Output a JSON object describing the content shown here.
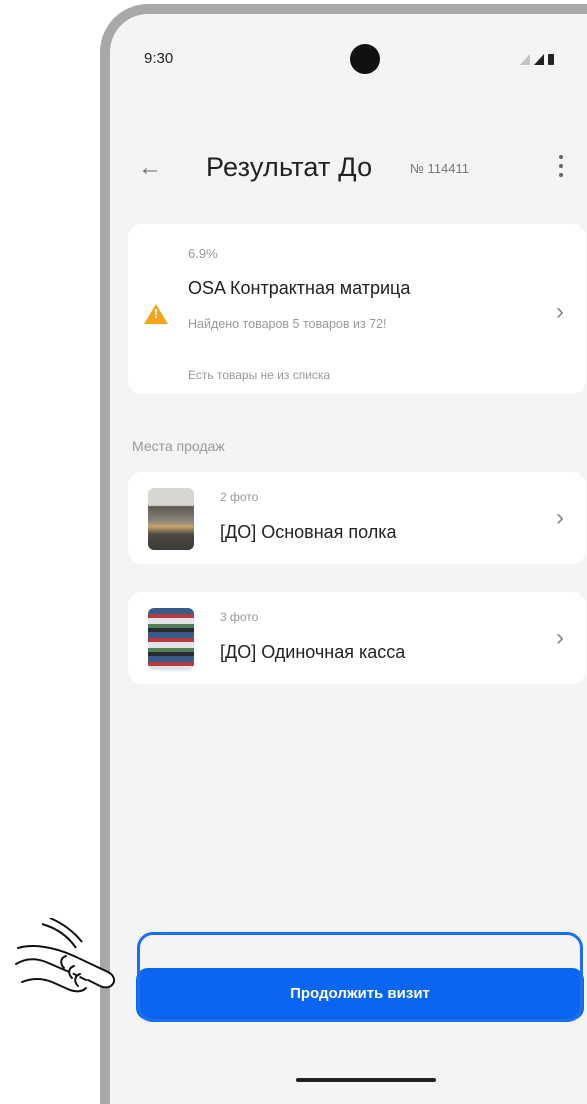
{
  "status_bar": {
    "time": "9:30"
  },
  "header": {
    "title": "Результат До",
    "ticket_number": "№ 114411"
  },
  "matrix_card": {
    "percent": "6.9%",
    "title": "OSA Контрактная матрица",
    "subtitle": "Найдено товаров 5 товаров из 72!",
    "note": "Есть товары не из списка"
  },
  "sales_places": {
    "section_label": "Места продаж",
    "items": [
      {
        "photo_count": "2 фото",
        "name": "[ДО] Основная полка"
      },
      {
        "photo_count": "3 фото",
        "name": "[ДО] Одиночная касса"
      }
    ]
  },
  "cta": {
    "label": "Продолжить визит"
  },
  "colors": {
    "accent": "#0a66f2",
    "warning": "#f3a51c",
    "background": "#f4f4f4"
  }
}
